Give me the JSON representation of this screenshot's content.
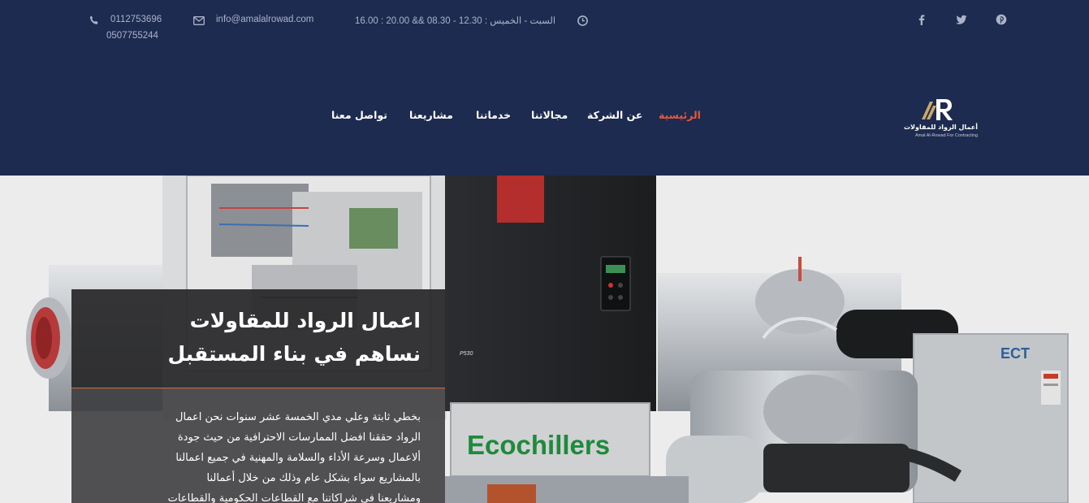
{
  "topbar": {
    "phone1": "0112753696",
    "phone2": "0507755244",
    "email": "info@amalalrowad.com",
    "hours": "16.00 : 20.00 && 08.30 - 12.30 : السبت - الخميس",
    "icons": {
      "phone": "phone-icon",
      "email": "envelope-icon",
      "clock": "clock-icon",
      "facebook": "facebook-icon",
      "twitter": "twitter-icon",
      "pinterest": "pinterest-icon"
    }
  },
  "logo": {
    "name_ar": "أعمال الرواد للمقاولات",
    "name_en": "Amal Al-Rowad For Contracting"
  },
  "nav": {
    "home": "الرئيسية",
    "about": "عن الشركة",
    "fields": "مجالاتنا",
    "services": "خدماتنا",
    "projects": "مشاريعنا",
    "contact": "تواصل معنا"
  },
  "hero": {
    "title_line1": "اعمال الرواد للمقاولات",
    "title_line2": "نساهم في بناء المستقبل",
    "body_lines": [
      "بخطي ثابتة وعلي مدي الخمسة عشر سنوات نحن اعمال",
      "الرواد حققنا افضل الممارسات الاحترافية من حيث جودة",
      "ألاعمال وسرعة الأداء والسلامة والمهنية في جميع اعمالنا",
      "بالمشاريع سواء بشكل عام وذلك من خلال أعمالنا",
      "ومشاريعنا في شراكاتنا مع القطاعات الحكومية والقطاعات"
    ],
    "image_text": {
      "brand": "Ecochillers",
      "badge": "ECT",
      "model": "P530"
    }
  },
  "colors": {
    "header_bg": "#1e2b50",
    "nav_active": "#e8573a",
    "logo_gold": "#c9a96a"
  }
}
